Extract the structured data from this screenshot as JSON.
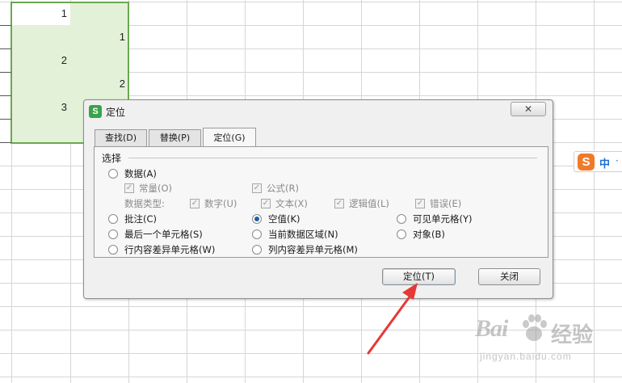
{
  "sheet": {
    "cells": [
      {
        "value": "1"
      },
      {
        "value": "1"
      },
      {
        "value": "2"
      },
      {
        "value": "2"
      },
      {
        "value": "3"
      }
    ],
    "selection_color": "#6aa84f",
    "selection_fill": "#e3f1d9"
  },
  "dialog": {
    "title": "定位",
    "app_icon_letter": "S",
    "app_icon_color": "#3aa34a",
    "close_glyph": "✕",
    "tabs": [
      {
        "label": "查找(D)",
        "active": false
      },
      {
        "label": "替换(P)",
        "active": false
      },
      {
        "label": "定位(G)",
        "active": true
      }
    ],
    "group_label": "选择",
    "options": {
      "data": {
        "label": "数据(A)",
        "checked": false
      },
      "constants": {
        "label": "常量(O)",
        "checked": true,
        "enabled": false
      },
      "formulas": {
        "label": "公式(R)",
        "checked": true,
        "enabled": false
      },
      "data_type_label": "数据类型:",
      "numbers": {
        "label": "数字(U)",
        "checked": true,
        "enabled": false
      },
      "text": {
        "label": "文本(X)",
        "checked": true,
        "enabled": false
      },
      "logicals": {
        "label": "逻辑值(L)",
        "checked": true,
        "enabled": false
      },
      "errors": {
        "label": "错误(E)",
        "checked": true,
        "enabled": false
      },
      "comments": {
        "label": "批注(C)",
        "checked": false
      },
      "blanks": {
        "label": "空值(K)",
        "checked": true
      },
      "visible_cells": {
        "label": "可见单元格(Y)",
        "checked": false
      },
      "last_cell": {
        "label": "最后一个单元格(S)",
        "checked": false
      },
      "current_region": {
        "label": "当前数据区域(N)",
        "checked": false
      },
      "objects": {
        "label": "对象(B)",
        "checked": false
      },
      "row_differences": {
        "label": "行内容差异单元格(W)",
        "checked": false
      },
      "column_differences": {
        "label": "列内容差异单元格(M)",
        "checked": false
      }
    },
    "buttons": {
      "locate": "定位(T)",
      "close": "关闭"
    }
  },
  "ime": {
    "logo": "S",
    "language": "中",
    "more": "·",
    "logo_color": "#f07a2a"
  },
  "watermark": {
    "brand": "Bai",
    "cn": "经验",
    "url": "jingyan.baidu.com"
  },
  "annotation": {
    "arrow_color": "#e53935"
  }
}
